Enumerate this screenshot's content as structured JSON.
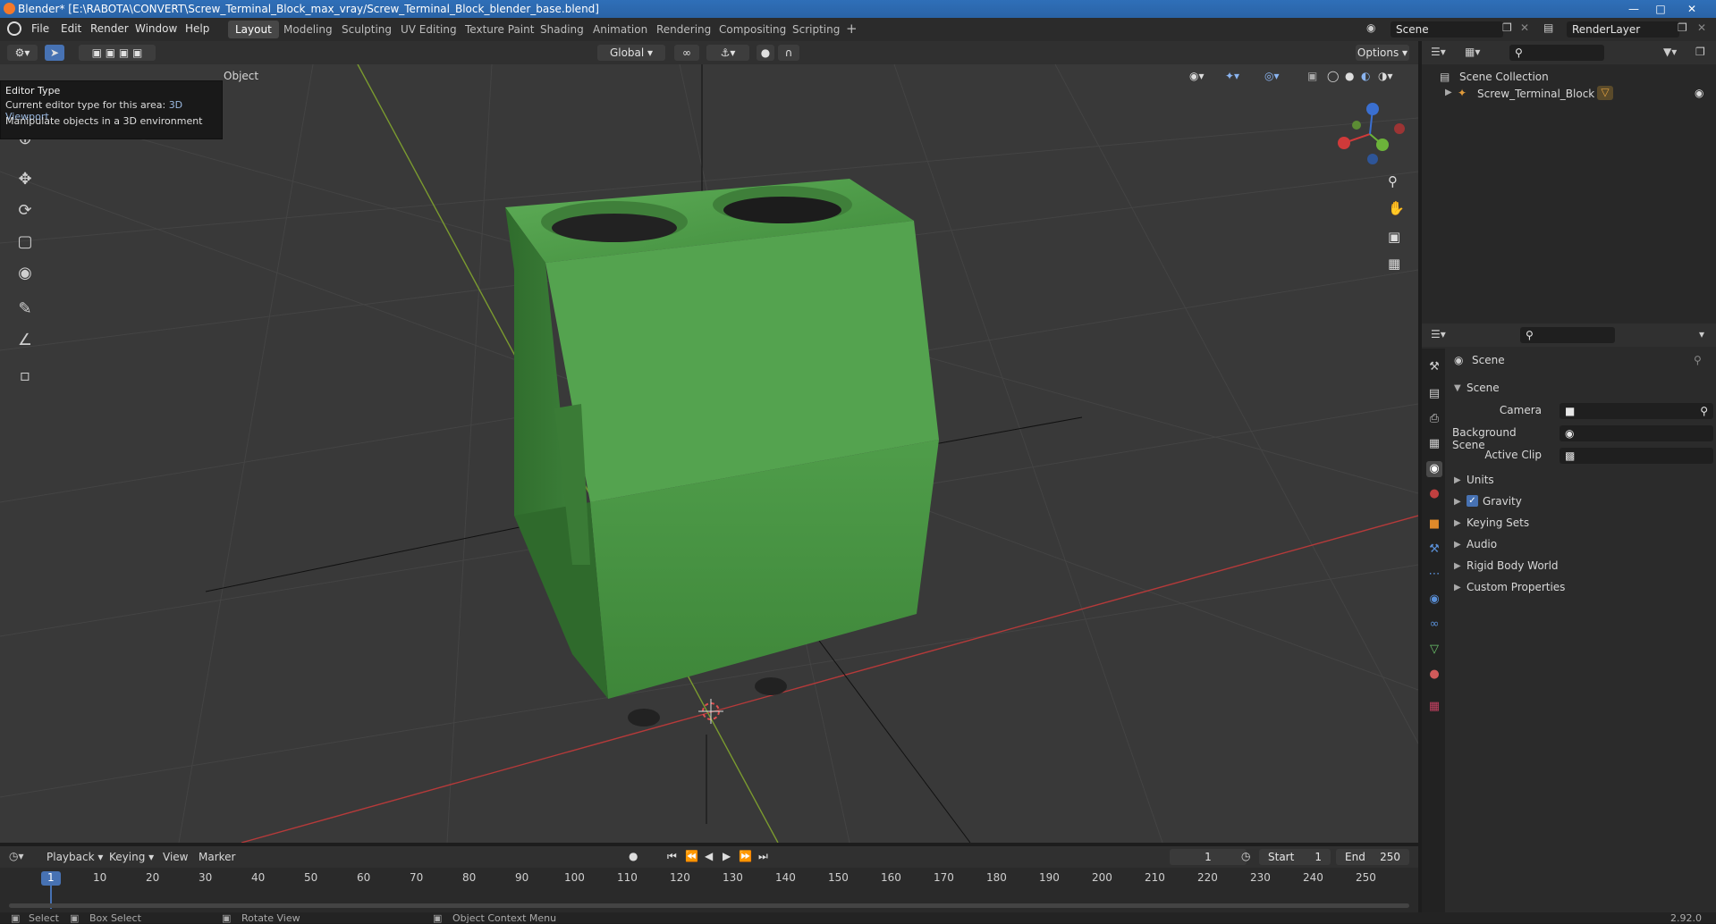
{
  "window": {
    "title": "Blender* [E:\\RABOTA\\CONVERT\\Screw_Terminal_Block_max_vray/Screw_Terminal_Block_blender_base.blend]"
  },
  "menu": [
    "File",
    "Edit",
    "Render",
    "Window",
    "Help"
  ],
  "workspaces": [
    "Layout",
    "Modeling",
    "Sculpting",
    "UV Editing",
    "Texture Paint",
    "Shading",
    "Animation",
    "Rendering",
    "Compositing",
    "Scripting"
  ],
  "scene_field": "Scene",
  "renderlayer_field": "RenderLayer",
  "viewport_header": {
    "transform_orientation": "Global",
    "options_label": "Options",
    "object_menu": "Object"
  },
  "tooltip": {
    "title": "Editor Type",
    "line1_label": "Current editor type for this area:",
    "line1_value": "3D Viewport",
    "line2": "Manipulate objects in a 3D environment"
  },
  "outliner": {
    "root": "Scene Collection",
    "item": "Screw_Terminal_Block"
  },
  "properties": {
    "breadcrumb": "Scene",
    "section": "Scene",
    "camera_label": "Camera",
    "background_scene_label": "Background Scene",
    "active_clip_label": "Active Clip",
    "panels": [
      "Units",
      "Gravity",
      "Keying Sets",
      "Audio",
      "Rigid Body World",
      "Custom Properties"
    ],
    "gravity_checked": true
  },
  "timeline": {
    "menus": [
      "Playback",
      "Keying",
      "View",
      "Marker"
    ],
    "current_frame": "1",
    "start_label": "Start",
    "start_value": "1",
    "end_label": "End",
    "end_value": "250",
    "ticks": [
      "1",
      "10",
      "20",
      "30",
      "40",
      "50",
      "60",
      "70",
      "80",
      "90",
      "100",
      "110",
      "120",
      "130",
      "140",
      "150",
      "160",
      "170",
      "180",
      "190",
      "200",
      "210",
      "220",
      "230",
      "240",
      "250"
    ]
  },
  "statusbar": {
    "select": "Select",
    "box_select": "Box Select",
    "rotate_view": "Rotate View",
    "context_menu": "Object Context Menu",
    "version": "2.92.0"
  },
  "colors": {
    "accent": "#4772b3",
    "object_green": "#4c9a47"
  }
}
